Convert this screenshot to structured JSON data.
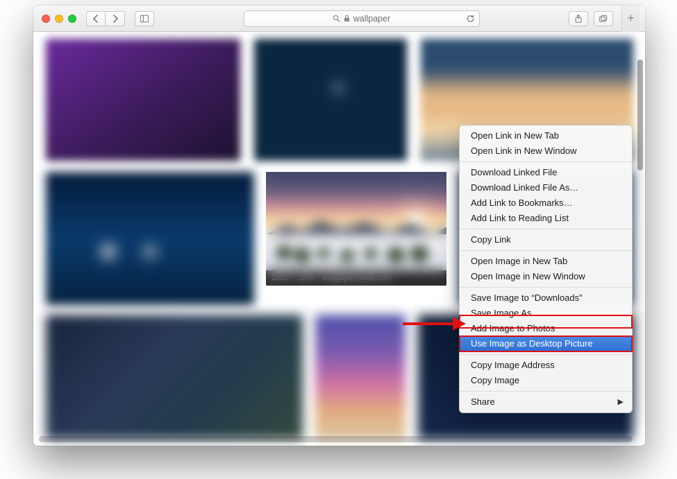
{
  "toolbar": {
    "address_text": "wallpaper"
  },
  "selected_image": {
    "caption": "1920 × 1200 - wallpaperswide.com"
  },
  "context_menu": {
    "groups": [
      [
        "Open Link in New Tab",
        "Open Link in New Window"
      ],
      [
        "Download Linked File",
        "Download Linked File As…",
        "Add Link to Bookmarks…",
        "Add Link to Reading List"
      ],
      [
        "Copy Link"
      ],
      [
        "Open Image in New Tab",
        "Open Image in New Window"
      ],
      [
        "Save Image to “Downloads”",
        "Save Image As…",
        "Add Image to Photos",
        "Use Image as Desktop Picture"
      ],
      [
        "Copy Image Address",
        "Copy Image"
      ],
      [
        "Share"
      ]
    ],
    "highlighted": "Use Image as Desktop Picture",
    "submenu_items": [
      "Share"
    ]
  }
}
